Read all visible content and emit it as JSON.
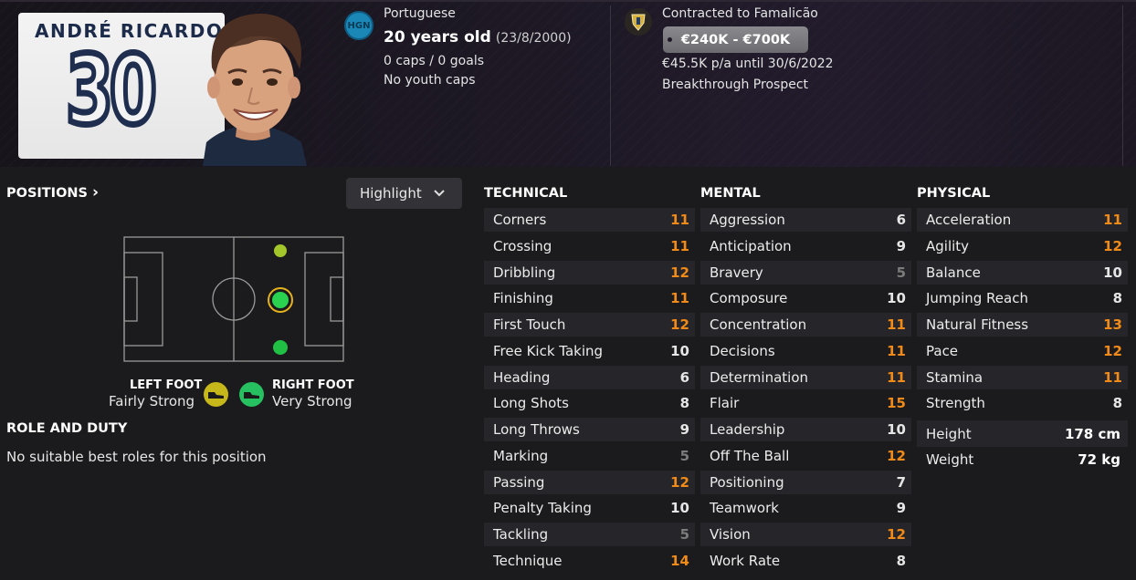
{
  "player": {
    "shirt_name": "ANDRÉ RICARDO",
    "shirt_number": "30",
    "nation_badge": "HGN",
    "nationality": "Portuguese",
    "age": "20 years old",
    "dob": "(23/8/2000)",
    "caps_goals": "0 caps / 0 goals",
    "youth_caps": "No youth caps"
  },
  "contract": {
    "club": "Contracted to Famalicão",
    "value_range": "€240K - €700K",
    "wage": "€45.5K p/a until 30/6/2022",
    "status": "Breakthrough Prospect"
  },
  "positions": {
    "heading": "POSITIONS",
    "heading_chevron": "›",
    "highlight_label": "Highlight",
    "left_foot_label": "LEFT FOOT",
    "left_foot_value": "Fairly Strong",
    "right_foot_label": "RIGHT FOOT",
    "right_foot_value": "Very Strong",
    "colors": {
      "left_foot": "#c6b81a",
      "right_foot": "#27c060",
      "natural": "#2ad34f",
      "accomplished": "#9fc12b"
    }
  },
  "role": {
    "heading": "ROLE AND DUTY",
    "text": "No suitable best roles for this position"
  },
  "attributes": {
    "technical": {
      "title": "TECHNICAL",
      "rows": [
        {
          "name": "Corners",
          "value": "11",
          "tone": "orange"
        },
        {
          "name": "Crossing",
          "value": "11",
          "tone": "orange"
        },
        {
          "name": "Dribbling",
          "value": "12",
          "tone": "orange"
        },
        {
          "name": "Finishing",
          "value": "11",
          "tone": "orange"
        },
        {
          "name": "First Touch",
          "value": "12",
          "tone": "orange"
        },
        {
          "name": "Free Kick Taking",
          "value": "10",
          "tone": "white"
        },
        {
          "name": "Heading",
          "value": "6",
          "tone": "white"
        },
        {
          "name": "Long Shots",
          "value": "8",
          "tone": "white"
        },
        {
          "name": "Long Throws",
          "value": "9",
          "tone": "white"
        },
        {
          "name": "Marking",
          "value": "5",
          "tone": "grey"
        },
        {
          "name": "Passing",
          "value": "12",
          "tone": "orange"
        },
        {
          "name": "Penalty Taking",
          "value": "10",
          "tone": "white"
        },
        {
          "name": "Tackling",
          "value": "5",
          "tone": "grey"
        },
        {
          "name": "Technique",
          "value": "14",
          "tone": "orange"
        }
      ]
    },
    "mental": {
      "title": "MENTAL",
      "rows": [
        {
          "name": "Aggression",
          "value": "6",
          "tone": "white"
        },
        {
          "name": "Anticipation",
          "value": "9",
          "tone": "white"
        },
        {
          "name": "Bravery",
          "value": "5",
          "tone": "grey"
        },
        {
          "name": "Composure",
          "value": "10",
          "tone": "white"
        },
        {
          "name": "Concentration",
          "value": "11",
          "tone": "orange"
        },
        {
          "name": "Decisions",
          "value": "11",
          "tone": "orange"
        },
        {
          "name": "Determination",
          "value": "11",
          "tone": "orange"
        },
        {
          "name": "Flair",
          "value": "15",
          "tone": "orange"
        },
        {
          "name": "Leadership",
          "value": "10",
          "tone": "white"
        },
        {
          "name": "Off The Ball",
          "value": "12",
          "tone": "orange"
        },
        {
          "name": "Positioning",
          "value": "7",
          "tone": "white"
        },
        {
          "name": "Teamwork",
          "value": "9",
          "tone": "white"
        },
        {
          "name": "Vision",
          "value": "12",
          "tone": "orange"
        },
        {
          "name": "Work Rate",
          "value": "8",
          "tone": "white"
        }
      ]
    },
    "physical": {
      "title": "PHYSICAL",
      "rows": [
        {
          "name": "Acceleration",
          "value": "11",
          "tone": "orange"
        },
        {
          "name": "Agility",
          "value": "12",
          "tone": "orange"
        },
        {
          "name": "Balance",
          "value": "10",
          "tone": "white"
        },
        {
          "name": "Jumping Reach",
          "value": "8",
          "tone": "white"
        },
        {
          "name": "Natural Fitness",
          "value": "13",
          "tone": "orange"
        },
        {
          "name": "Pace",
          "value": "12",
          "tone": "orange"
        },
        {
          "name": "Stamina",
          "value": "11",
          "tone": "orange"
        },
        {
          "name": "Strength",
          "value": "8",
          "tone": "white"
        }
      ],
      "height_label": "Height",
      "height_value": "178 cm",
      "weight_label": "Weight",
      "weight_value": "72 kg"
    }
  }
}
